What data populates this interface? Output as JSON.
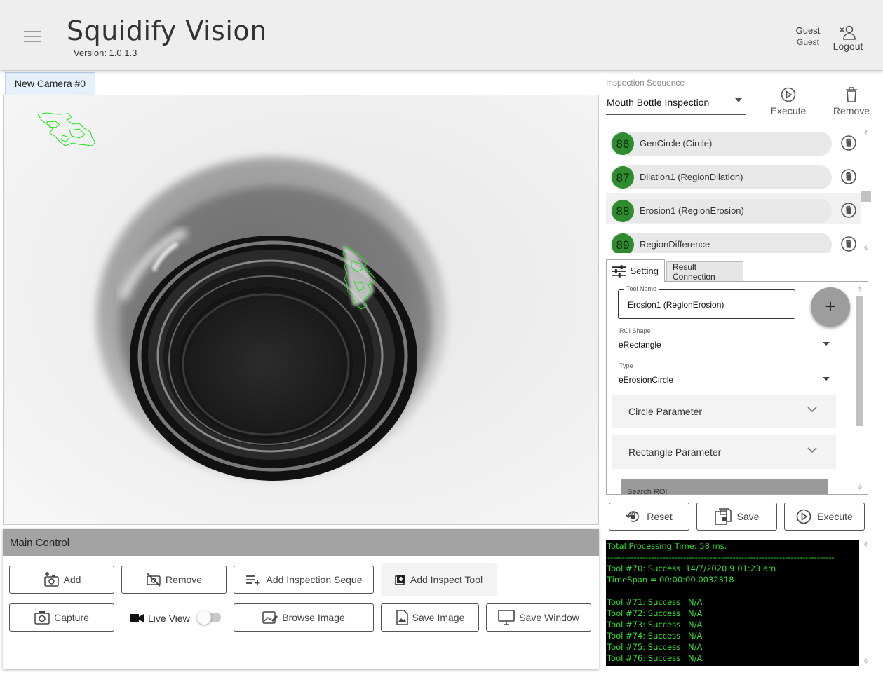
{
  "app": {
    "title": "Squidify Vision",
    "version": "Version: 1.0.1.3"
  },
  "user": {
    "name": "Guest",
    "role": "Guest",
    "logout_label": "Logout"
  },
  "camera": {
    "tab_label": "New Camera #0"
  },
  "main_control": {
    "title": "Main Control",
    "buttons": {
      "add": "Add",
      "remove": "Remove",
      "add_sequence": "Add Inspection Seque",
      "add_tool": "Add Inspect Tool",
      "capture": "Capture",
      "live_view": "Live View",
      "browse": "Browse Image",
      "save_image": "Save Image",
      "save_window": "Save Window"
    },
    "live_view_on": false
  },
  "sequence": {
    "label": "Inspection Sequence",
    "selected": "Mouth Bottle Inspection",
    "execute_label": "Execute",
    "remove_label": "Remove"
  },
  "tools": [
    {
      "id": "86",
      "name": "GenCircle (Circle)"
    },
    {
      "id": "87",
      "name": "Dilation1 (RegionDilation)"
    },
    {
      "id": "88",
      "name": "Erosion1 (RegionErosion)"
    },
    {
      "id": "89",
      "name": "RegionDifference"
    }
  ],
  "settings": {
    "tab_setting": "Setting",
    "tab_result": "Result Connection",
    "tool_name_label": "Tool Name",
    "tool_name_value": "Erosion1 (RegionErosion)",
    "roi_shape_label": "ROI Shape",
    "roi_shape_value": "eRectangle",
    "type_label": "Type",
    "type_value": "eErosionCircle",
    "circle_param": "Circle Parameter",
    "rect_param": "Rectangle Parameter",
    "search_roi": "Search ROI",
    "fab": "+"
  },
  "actions": {
    "reset": "Reset",
    "save": "Save",
    "execute": "Execute"
  },
  "log": [
    "Total Processing Time: 58 ms.",
    "------------------------------------------------------------------------------",
    "Tool #70: Success  14/7/2020 9:01:23 am",
    "TimeSpan = 00:00:00.0032318",
    "",
    "Tool #71: Success   N/A",
    "Tool #72: Success   N/A",
    "Tool #73: Success   N/A",
    "Tool #74: Success   N/A",
    "Tool #75: Success   N/A",
    "Tool #76: Success   N/A"
  ],
  "colors": {
    "badge": "#2e8b2e",
    "overlay": "#19e619",
    "log_text": "#33dd33",
    "header_bg": "#eeeeee"
  }
}
